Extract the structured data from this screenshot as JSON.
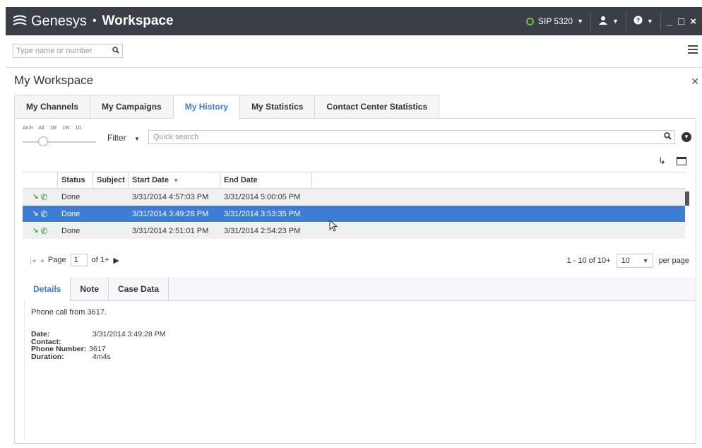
{
  "titlebar": {
    "brand": "Genesys",
    "separator": "•",
    "product": "Workspace",
    "status_label": "SIP 5320",
    "status_color": "#6bc04b",
    "user_icon": "agent-icon",
    "help_icon": "help-icon",
    "window_controls": [
      "minimize-icon",
      "maximize-icon",
      "close-icon"
    ]
  },
  "search": {
    "placeholder": "Type name or number"
  },
  "workspace": {
    "title": "My Workspace",
    "tabs": [
      {
        "label": "My Channels",
        "active": false
      },
      {
        "label": "My Campaigns",
        "active": false
      },
      {
        "label": "My History",
        "active": true
      },
      {
        "label": "My Statistics",
        "active": false
      },
      {
        "label": "Contact Center Statistics",
        "active": false
      }
    ]
  },
  "history": {
    "range_labels": [
      "Arch",
      "All",
      "1M",
      "1W",
      "1D"
    ],
    "filter_label": "Filter",
    "quick_search_placeholder": "Quick search",
    "columns": [
      "Status",
      "Subject",
      "Start Date",
      "End Date"
    ],
    "rows": [
      {
        "status": "Done",
        "subject": "",
        "start": "3/31/2014 4:57:03 PM",
        "end": "3/31/2014 5:00:05 PM",
        "selected": false
      },
      {
        "status": "Done",
        "subject": "",
        "start": "3/31/2014 3:49:28 PM",
        "end": "3/31/2014 3:53:35 PM",
        "selected": true
      },
      {
        "status": "Done",
        "subject": "",
        "start": "3/31/2014 2:51:01 PM",
        "end": "3/31/2014 2:54:23 PM",
        "selected": false
      }
    ],
    "pager": {
      "page_label": "Page",
      "page_value": "1",
      "of_label": "of 1+",
      "range_text": "1 - 10 of 10+",
      "per_page_value": "10",
      "per_page_label": "per page"
    }
  },
  "details": {
    "tabs": [
      {
        "label": "Details",
        "active": true
      },
      {
        "label": "Note",
        "active": false
      },
      {
        "label": "Case Data",
        "active": false
      }
    ],
    "summary": "Phone call from 3617.",
    "fields": [
      {
        "label": "Date:",
        "value": "3/31/2014 3:49:28 PM"
      },
      {
        "label": "Contact:",
        "value": ""
      },
      {
        "label": "Phone Number:",
        "value": "3617"
      },
      {
        "label": "Duration:",
        "value": "4m4s"
      }
    ]
  }
}
